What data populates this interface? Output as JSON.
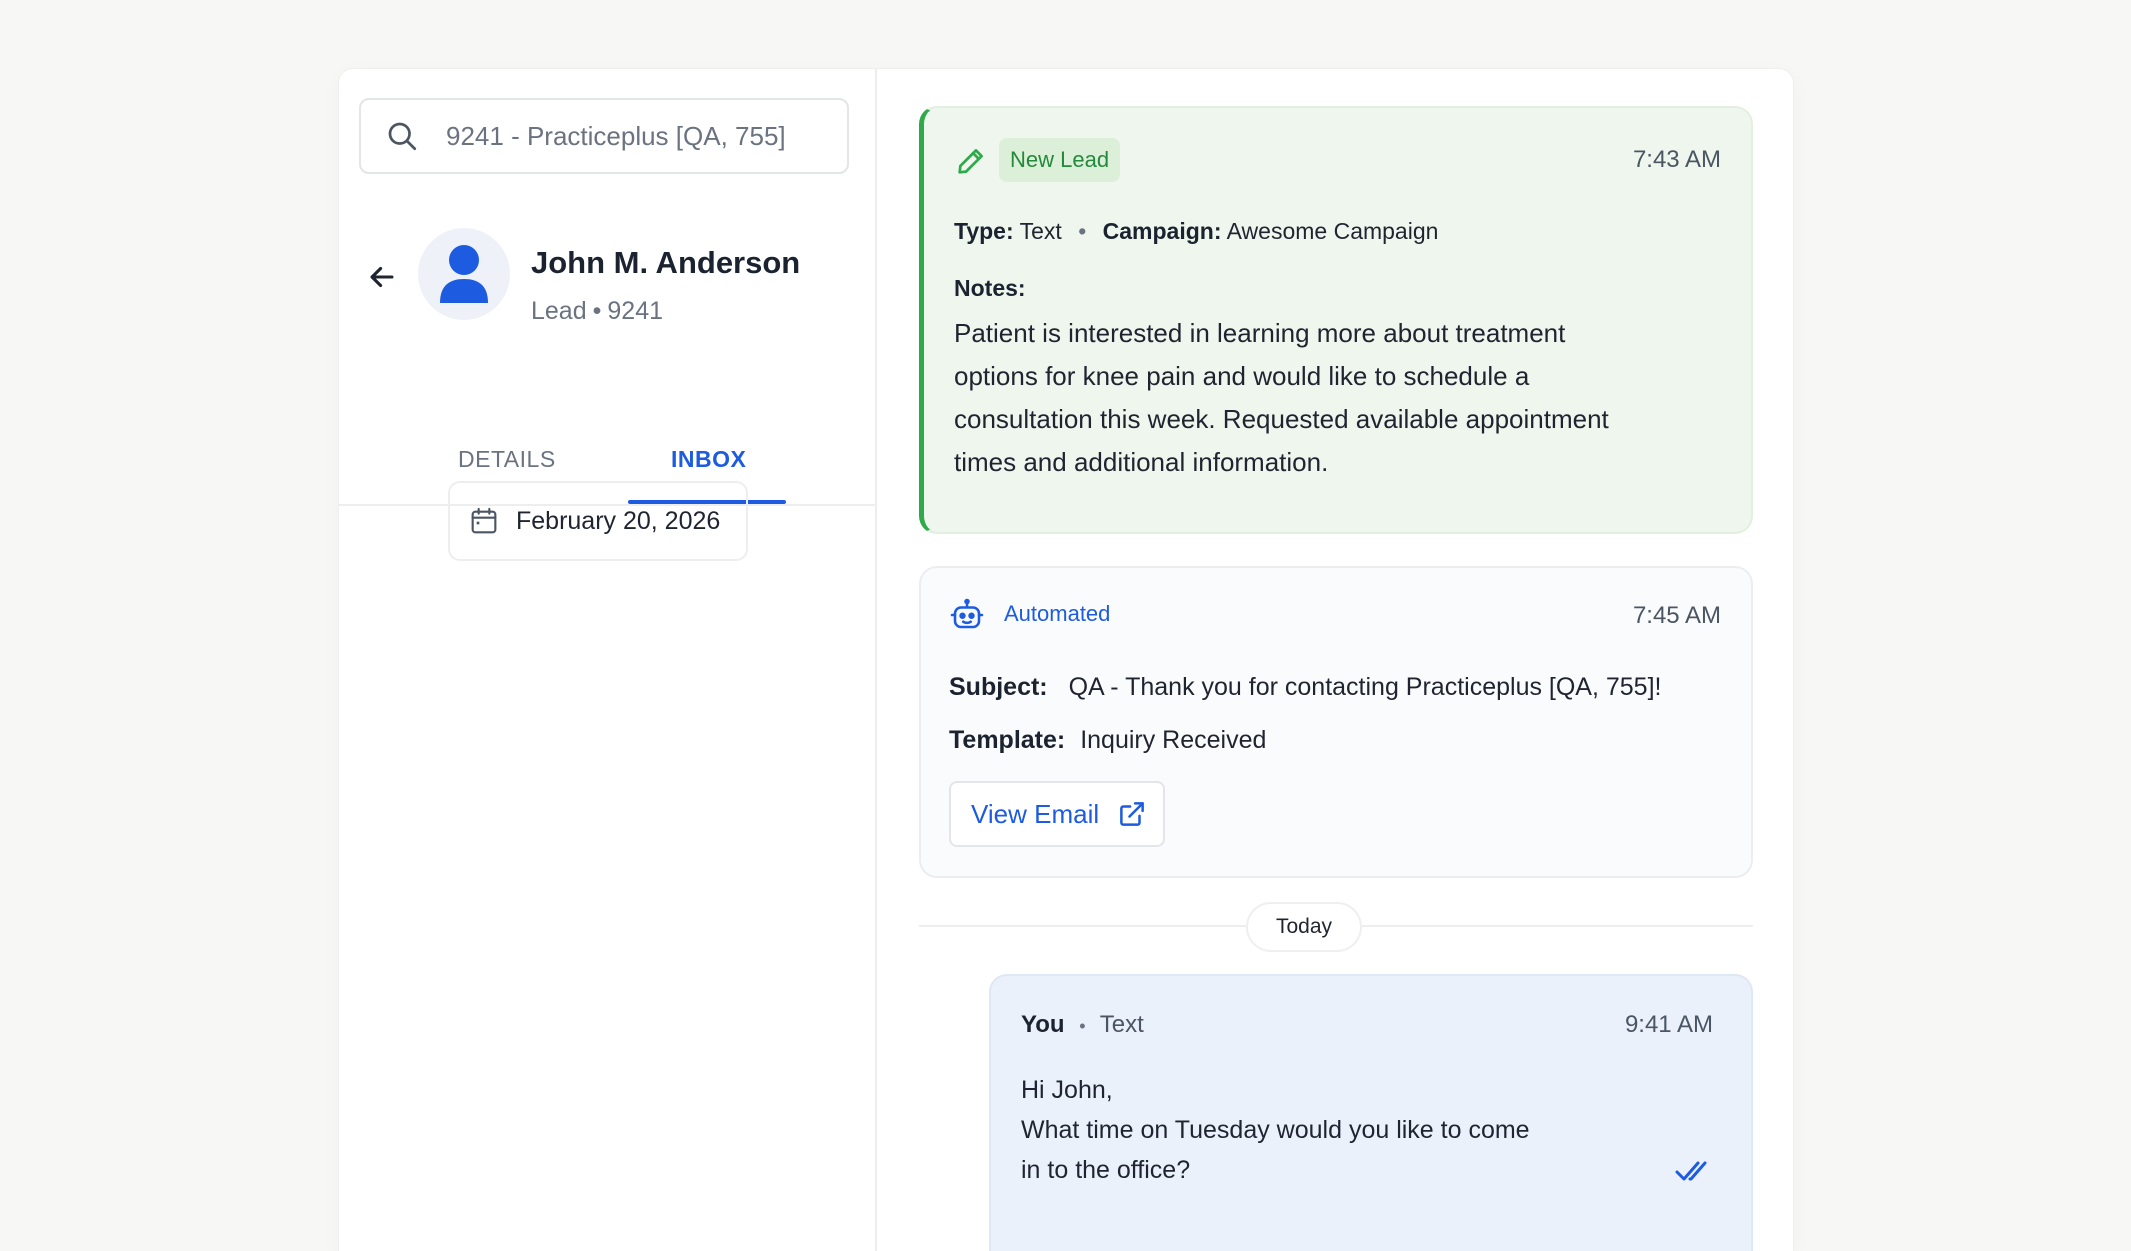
{
  "search": {
    "value": "9241 - Practiceplus [QA, 755]"
  },
  "contact": {
    "name": "John M. Anderson",
    "type": "Lead",
    "id": "9241"
  },
  "tabs": {
    "details": "DETAILS",
    "inbox": "INBOX",
    "active": "INBOX"
  },
  "date_filter": {
    "value": "February 20, 2026"
  },
  "lead_card": {
    "badge": "New Lead",
    "time": "7:43 AM",
    "type_label": "Type:",
    "type_value": "Text",
    "campaign_label": "Campaign:",
    "campaign_value": "Awesome Campaign",
    "notes_label": "Notes:",
    "notes": "Patient is interested in learning more about treatment options for knee pain and would like to schedule a consultation this week. Requested available appointment times and additional information."
  },
  "auto_card": {
    "badge": "Automated",
    "time": "7:45 AM",
    "subject_label": "Subject:",
    "subject_value": "QA - Thank you for contacting Practiceplus [QA, 755]!",
    "template_label": "Template:",
    "template_value": "Inquiry Received",
    "view_button": "View Email"
  },
  "separator": {
    "label": "Today"
  },
  "message": {
    "sender": "You",
    "channel": "Text",
    "time": "9:41 AM",
    "line1": "Hi John,",
    "line2": "What time on Tuesday would you like to come",
    "line3": "in to the office?"
  },
  "colors": {
    "accent_blue": "#1d5ce0",
    "lead_green": "#2eaa4a",
    "lead_bg": "#eff6ed",
    "message_bg": "#ebf1fb"
  }
}
